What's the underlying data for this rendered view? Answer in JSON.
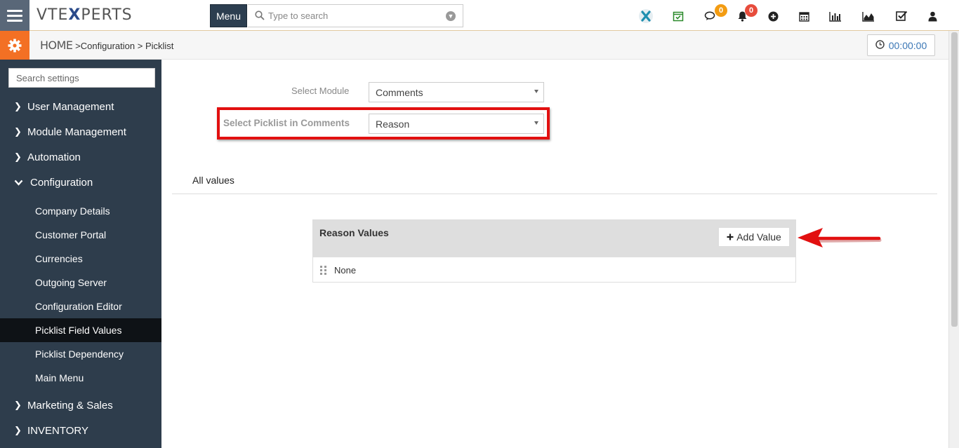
{
  "header": {
    "logo_prefix": "VTE",
    "logo_x": "X",
    "logo_suffix": "PERTS",
    "menu_label": "Menu",
    "search_placeholder": "Type to search",
    "chat_badge": "0",
    "notification_badge": "0",
    "accent_color": "#f37024",
    "badge_orange": "#f39c12",
    "badge_red": "#e74c3c"
  },
  "breadcrumb": {
    "home": "HOME",
    "sep1": ">",
    "level1": "Configuration",
    "sep2": ">",
    "level2": "Picklist"
  },
  "timer": {
    "value": "00:00:00"
  },
  "sidebar": {
    "search_placeholder": "Search settings",
    "sections": [
      {
        "label": "User Management",
        "expanded": false
      },
      {
        "label": "Module Management",
        "expanded": false
      },
      {
        "label": "Automation",
        "expanded": false
      },
      {
        "label": "Configuration",
        "expanded": true
      },
      {
        "label": "Marketing & Sales",
        "expanded": false
      },
      {
        "label": "INVENTORY",
        "expanded": false
      }
    ],
    "config_items": [
      {
        "label": "Company Details"
      },
      {
        "label": "Customer Portal"
      },
      {
        "label": "Currencies"
      },
      {
        "label": "Outgoing Server"
      },
      {
        "label": "Configuration Editor"
      },
      {
        "label": "Picklist Field Values",
        "active": true
      },
      {
        "label": "Picklist Dependency"
      },
      {
        "label": "Main Menu"
      }
    ]
  },
  "main": {
    "module_label": "Select Module",
    "module_value": "Comments",
    "picklist_label": "Select Picklist in Comments",
    "picklist_value": "Reason",
    "all_values_label": "All values",
    "panel_title": "Reason Values",
    "add_value_label": "Add Value",
    "values": [
      "None"
    ]
  }
}
